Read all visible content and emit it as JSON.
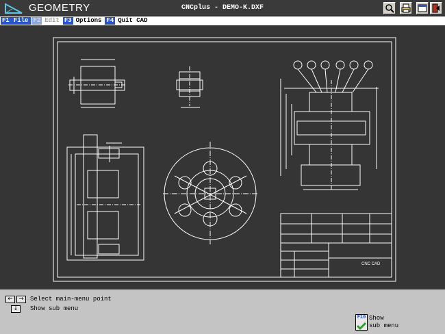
{
  "app": {
    "name": "GEOMETRY",
    "title": "CNCplus - DEMO-K.DXF"
  },
  "window_buttons": [
    "zoom-icon",
    "print-icon",
    "window-icon",
    "exit-icon"
  ],
  "menu": [
    {
      "key": "F1",
      "label": "File",
      "selected": true,
      "enabled": true
    },
    {
      "key": "F2",
      "label": "Edit",
      "selected": false,
      "enabled": false
    },
    {
      "key": "F3",
      "label": "Options",
      "selected": false,
      "enabled": true
    },
    {
      "key": "F4",
      "label": "Quit CAD",
      "selected": false,
      "enabled": true
    }
  ],
  "drawing": {
    "title_block_text": "CNC CAD"
  },
  "status": {
    "line1": "Select main-menu point",
    "line2": "Show sub menu",
    "f10_key": "F10",
    "f10_line1": "Show",
    "f10_line2": "sub menu"
  },
  "colors": {
    "menu_key": "#2a55c8",
    "canvas": "#353535",
    "checkmark": "#2e9e2e"
  }
}
